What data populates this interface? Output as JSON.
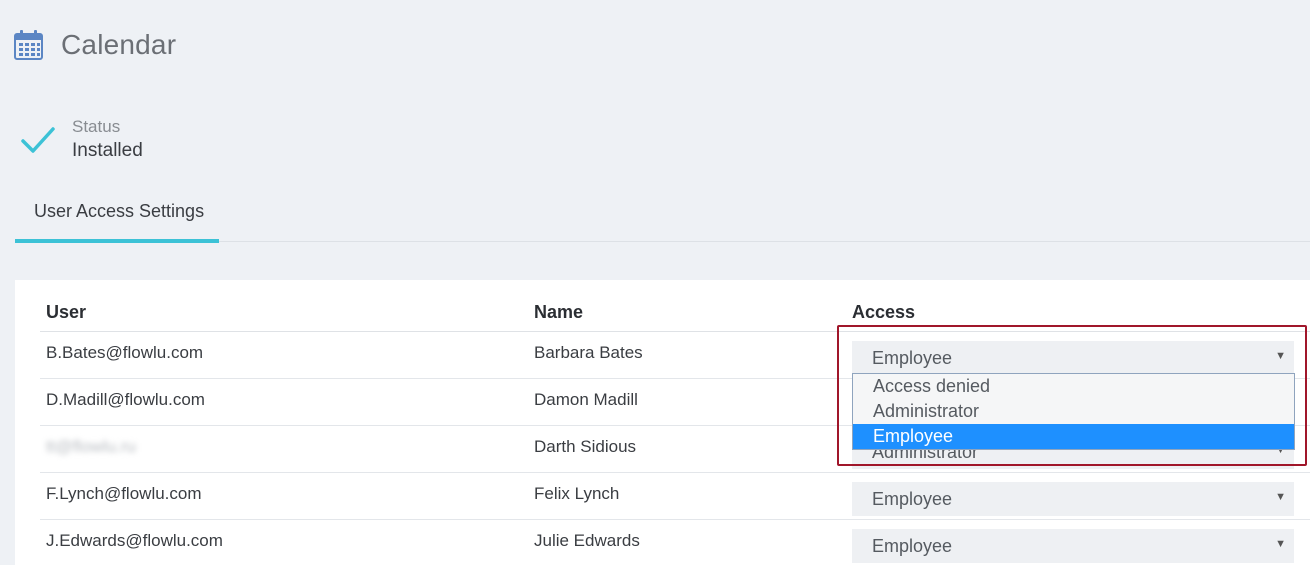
{
  "header": {
    "title": "Calendar",
    "icon": "calendar-icon"
  },
  "status": {
    "label": "Status",
    "value": "Installed",
    "icon": "check-icon",
    "accent": "#3cc2d6"
  },
  "tabs": [
    {
      "label": "User Access Settings",
      "active": true
    }
  ],
  "table": {
    "columns": {
      "user": "User",
      "name": "Name",
      "access": "Access"
    },
    "rows": [
      {
        "user": "B.Bates@flowlu.com",
        "name": "Barbara Bates",
        "access": "Employee"
      },
      {
        "user": "D.Madill@flowlu.com",
        "name": "Damon Madill",
        "access": ""
      },
      {
        "user": "tt@flowlu.ru",
        "name": "Darth Sidious",
        "access": "Administrator"
      },
      {
        "user": "F.Lynch@flowlu.com",
        "name": "Felix Lynch",
        "access": "Employee"
      },
      {
        "user": "J.Edwards@flowlu.com",
        "name": "Julie Edwards",
        "access": "Employee"
      }
    ]
  },
  "dropdown": {
    "options": [
      "Access denied",
      "Administrator",
      "Employee"
    ],
    "selected": "Employee",
    "selected_color": "#1e90ff",
    "highlight_color": "#a0162a"
  }
}
